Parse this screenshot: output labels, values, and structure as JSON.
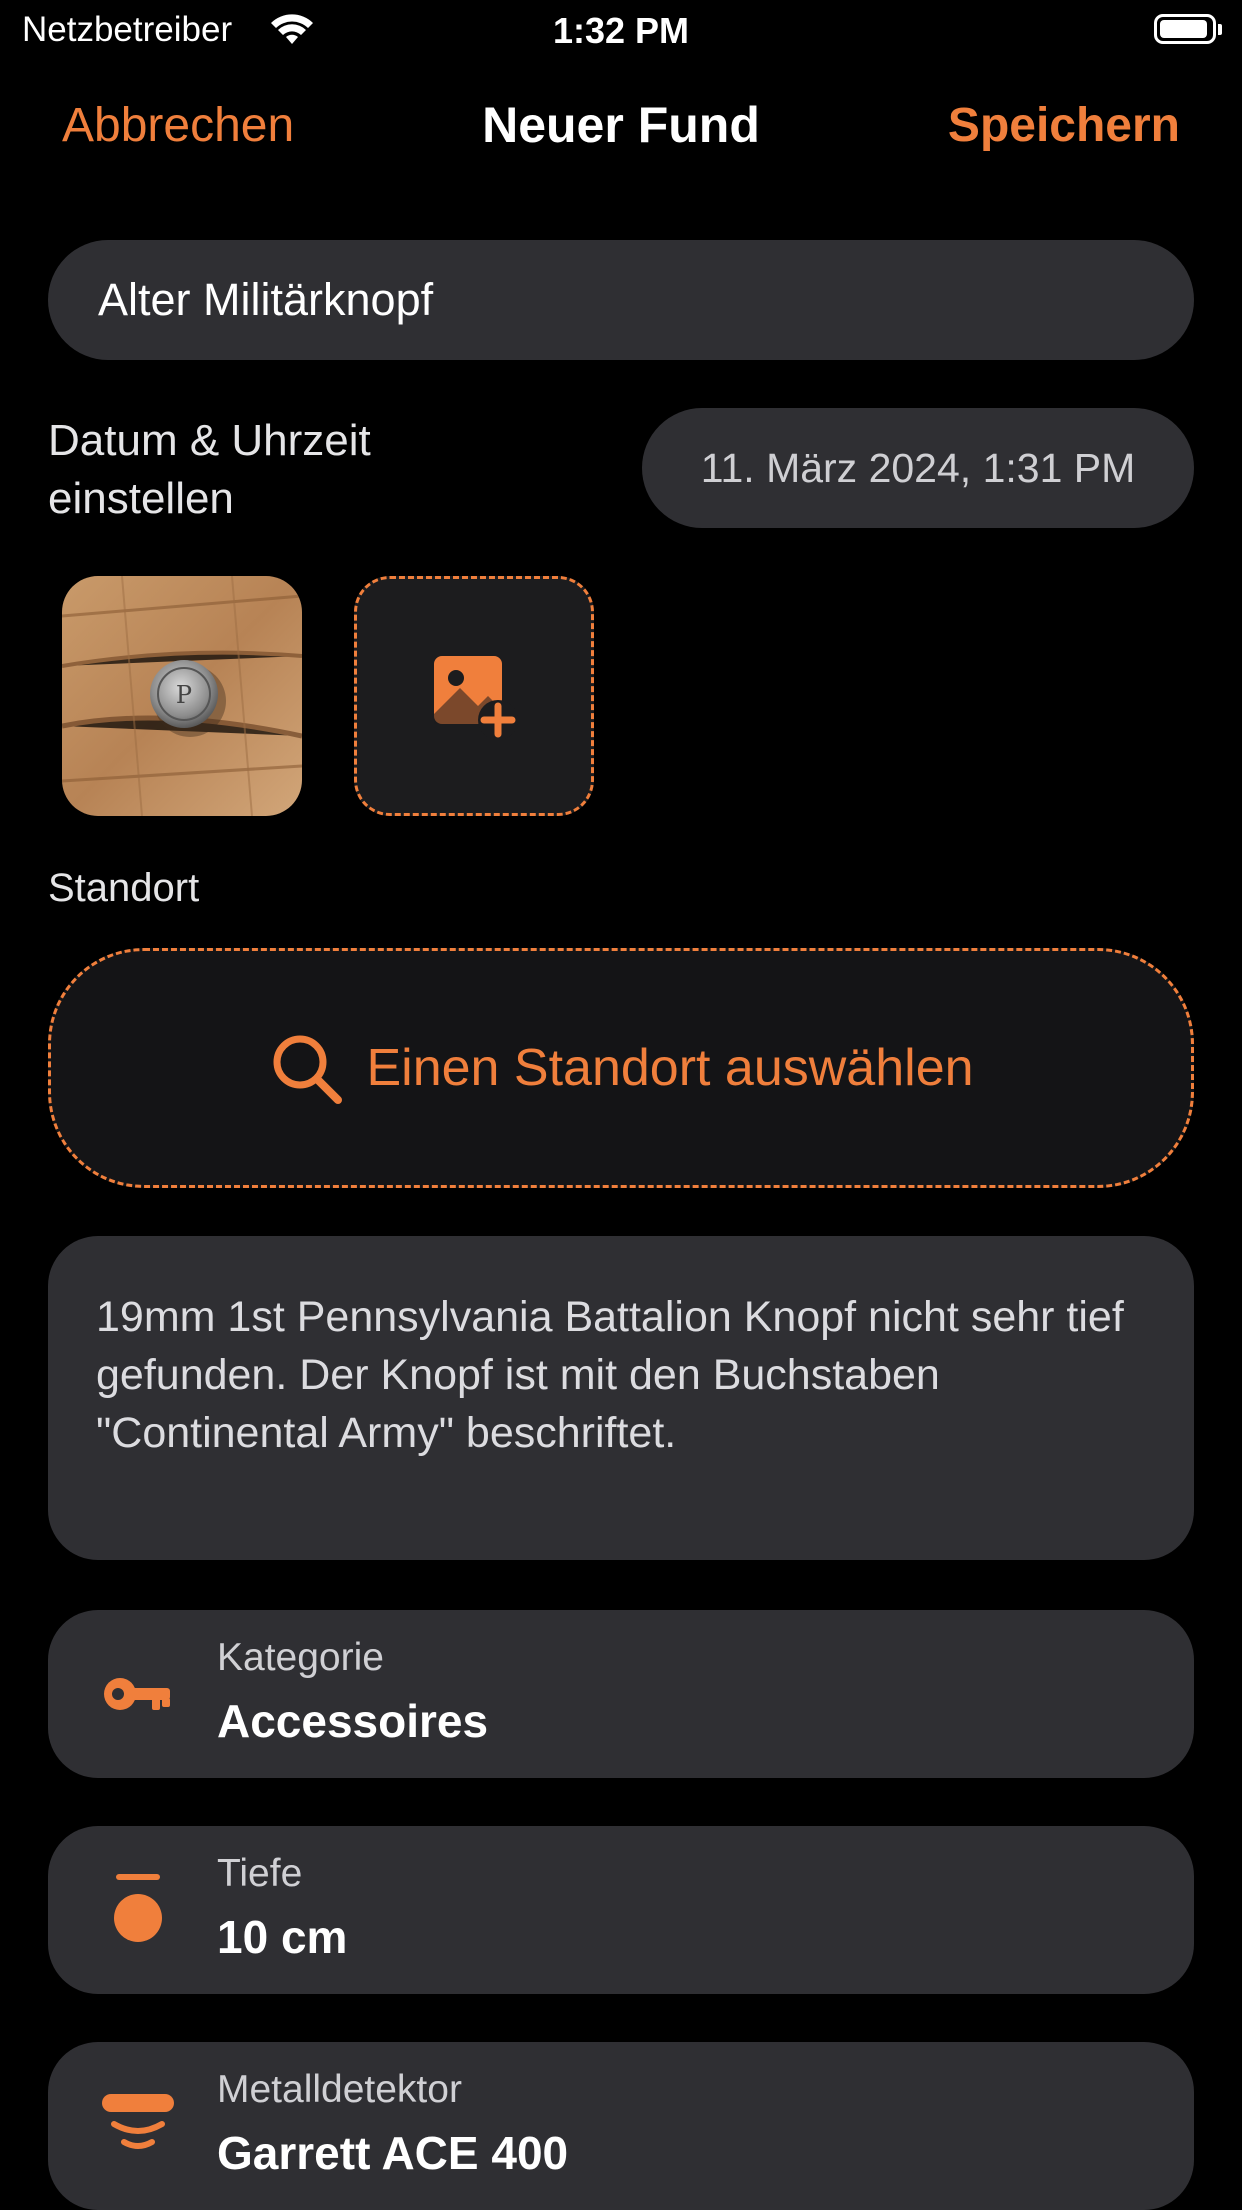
{
  "status_bar": {
    "carrier": "Netzbetreiber",
    "time": "1:32 PM",
    "battery_level": 0.95
  },
  "nav": {
    "cancel_label": "Abbrechen",
    "title": "Neuer Fund",
    "save_label": "Speichern"
  },
  "colors": {
    "accent": "#f07f3c",
    "background": "#000000",
    "field": "#2f2f33"
  },
  "form": {
    "title_value": "Alter Militärknopf",
    "date_label": "Datum & Uhrzeit einstellen",
    "date_value": "11. März 2024, 1:31 PM",
    "photos": [
      {
        "icon": "photo-thumbnail-button"
      }
    ],
    "add_photo_icon": "add-photo-icon",
    "location_section_label": "Standort",
    "location_button_label": "Einen Standort auswählen",
    "notes": "19mm 1st Pennsylvania Battalion Knopf nicht sehr tief gefunden. Der Knopf ist mit den Buchstaben \"Continental Army\" beschriftet.",
    "details": [
      {
        "label": "Kategorie",
        "value": "Accessoires",
        "icon": "key-icon"
      },
      {
        "label": "Tiefe",
        "value": "10 cm",
        "icon": "depth-icon"
      },
      {
        "label": "Metalldetektor",
        "value": "Garrett ACE 400",
        "icon": "detector-icon"
      }
    ]
  }
}
